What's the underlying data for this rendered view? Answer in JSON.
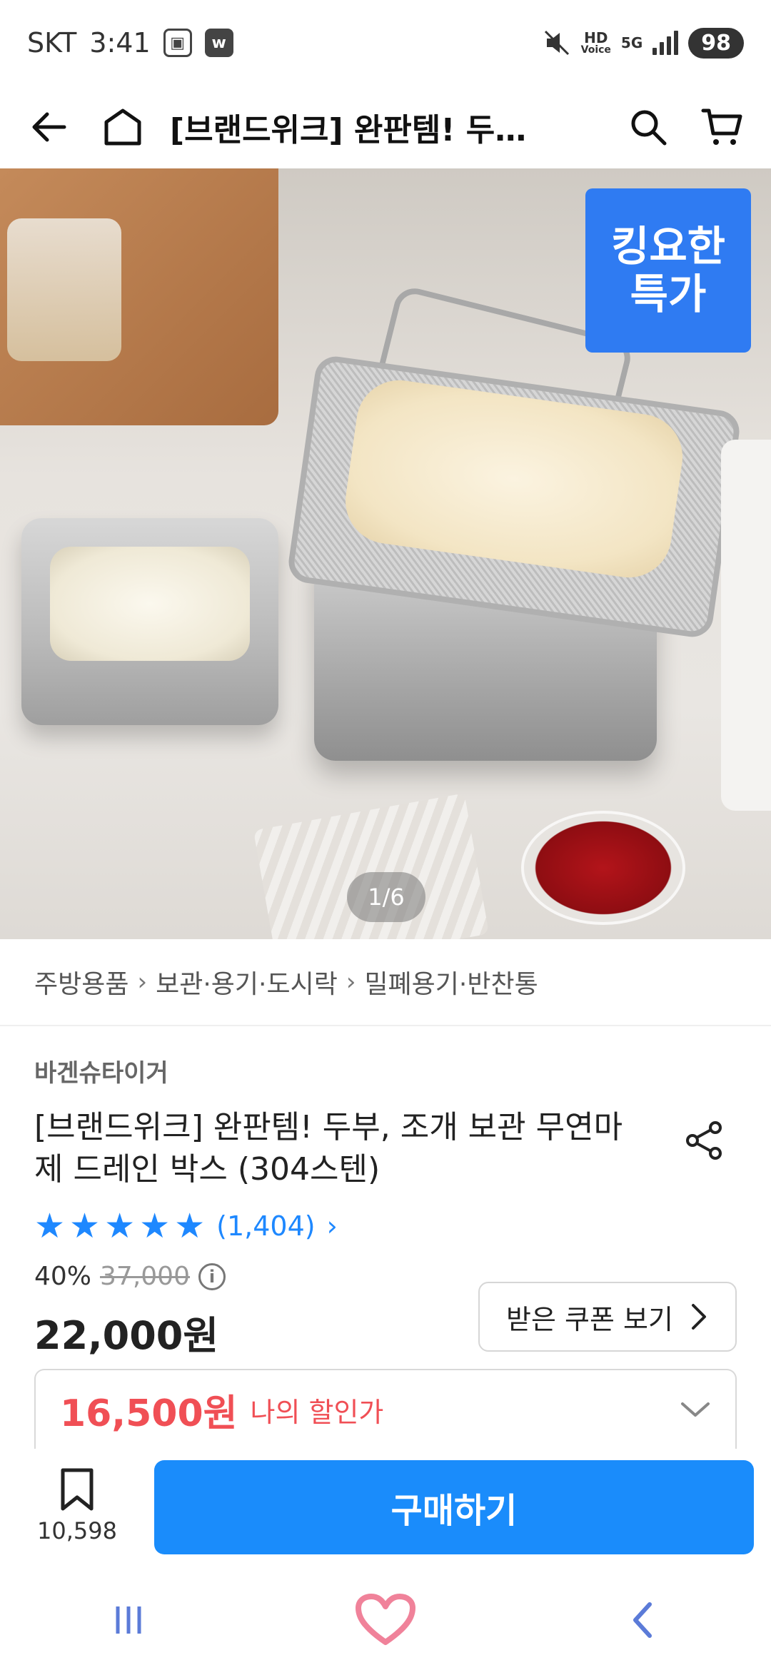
{
  "status": {
    "carrier": "SKT",
    "time": "3:41",
    "hd_label": "HD",
    "voice_label": "Voice",
    "net_label": "5G",
    "battery": "98"
  },
  "appbar": {
    "title": "[브랜드위크] 완판템! 두…"
  },
  "hero": {
    "badge_line1": "킹요한",
    "badge_line2": "특가",
    "pager": "1/6"
  },
  "breadcrumb": {
    "items": [
      "주방용품",
      "보관·용기·도시락",
      "밀폐용기·반찬통"
    ]
  },
  "product": {
    "brand": "바겐슈타이거",
    "title": "[브랜드위크] 완판템! 두부, 조개 보관 무연마제 드레인 박스 (304스텐)",
    "rating_count": "(1,404)",
    "discount_pct": "40%",
    "original_price": "37,000",
    "price": "22,000원",
    "coupon_button": "받은 쿠폰 보기",
    "my_price": "16,500원",
    "my_price_label": "나의 할인가"
  },
  "bottom": {
    "wish_count": "10,598",
    "buy_label": "구매하기"
  },
  "colors": {
    "accent": "#1a8cfb",
    "discount_red": "#f04f55",
    "badge_blue": "#2f7bf2",
    "star_blue": "#1e88ff"
  }
}
